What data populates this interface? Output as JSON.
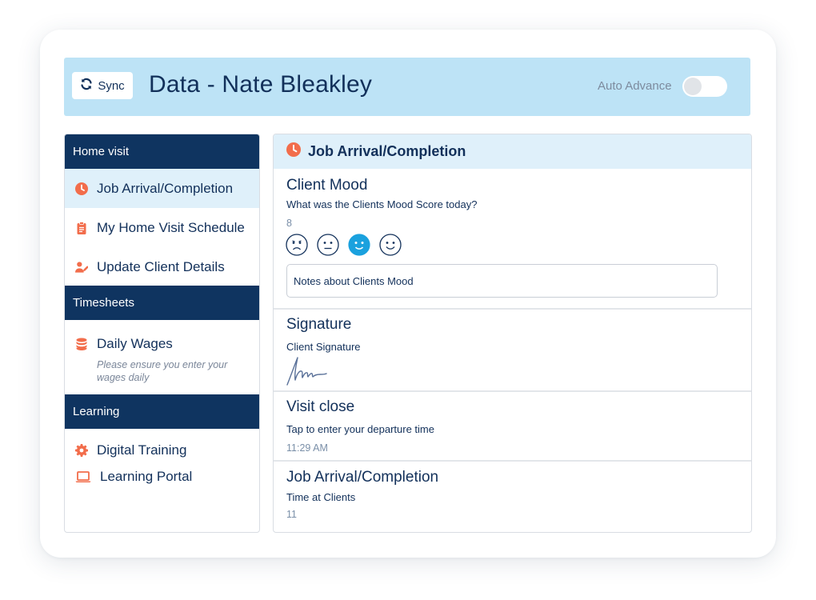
{
  "header": {
    "sync_label": "Sync",
    "title": "Data - Nate Bleakley",
    "auto_advance_label": "Auto Advance",
    "auto_advance_on": false
  },
  "sidebar": {
    "sections": [
      {
        "title": "Home visit",
        "items": [
          {
            "label": "Job Arrival/Completion",
            "icon": "clock-icon",
            "active": true
          },
          {
            "label": "My Home Visit Schedule",
            "icon": "clipboard-icon",
            "active": false
          },
          {
            "label": "Update Client Details",
            "icon": "user-edit-icon",
            "active": false
          }
        ]
      },
      {
        "title": "Timesheets",
        "items": [
          {
            "label": "Daily Wages",
            "icon": "coins-icon",
            "note": "Please ensure you enter your wages daily"
          }
        ]
      },
      {
        "title": "Learning",
        "items": [
          {
            "label": "Digital Training",
            "icon": "gear-icon"
          },
          {
            "label": "Learning Portal",
            "icon": "laptop-icon"
          }
        ]
      }
    ]
  },
  "main": {
    "title": "Job Arrival/Completion",
    "mood": {
      "title": "Client Mood",
      "question": "What was the Clients Mood Score today?",
      "score": "8",
      "faces": [
        "very-sad-face-icon",
        "neutral-face-icon",
        "happy-face-icon",
        "very-happy-face-icon"
      ],
      "selected_face": "happy-face-icon",
      "notes_placeholder": "Notes about Clients Mood"
    },
    "signature": {
      "title": "Signature",
      "label": "Client Signature"
    },
    "visit_close": {
      "title": "Visit close",
      "label": "Tap to enter your departure time",
      "value": "11:29 AM"
    },
    "completion": {
      "title": "Job Arrival/Completion",
      "label": "Time at Clients",
      "value": "11"
    }
  },
  "colors": {
    "navy": "#0f3460",
    "header_bg": "#bde3f6",
    "active_bg": "#dff0fa",
    "accent_orange": "#f26d4b",
    "accent_blue": "#1aa1de"
  }
}
